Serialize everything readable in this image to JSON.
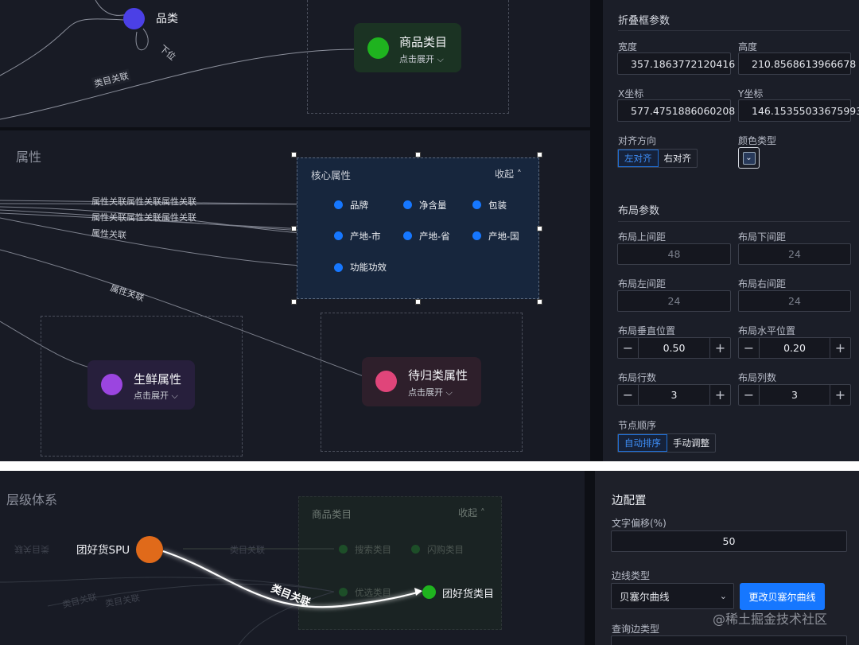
{
  "top_canvas": {
    "node_pinlei": "品类",
    "self_loop_label": "下位",
    "card_shangpin": {
      "title": "商品类目",
      "expand": "点击展开"
    },
    "edge_leimu": "类目关联"
  },
  "mid_canvas": {
    "group_title": "属性",
    "core_group": {
      "title": "核心属性",
      "collapse": "收起"
    },
    "attributes": [
      "品牌",
      "净含量",
      "包装",
      "产地-市",
      "产地-省",
      "产地-国",
      "功能功效"
    ],
    "edge_labels": [
      "属性关联属性关联属性关联",
      "属性关联属性关联属性关联",
      "属性关联",
      "属性关联"
    ],
    "card_shengxian": {
      "title": "生鲜属性",
      "expand": "点击展开"
    },
    "card_daigui": {
      "title": "待归类属性",
      "expand": "点击展开"
    }
  },
  "right_panel_top": {
    "section_fold": "折叠框参数",
    "width_label": "宽度",
    "width_value": "357.1863772120416",
    "height_label": "高度",
    "height_value": "210.8568613966678",
    "x_label": "X坐标",
    "x_value": "577.4751886060208",
    "y_label": "Y坐标",
    "y_value": "146.15355033675993",
    "align_label": "对齐方向",
    "align_left": "左对齐",
    "align_right": "右对齐",
    "color_label": "颜色类型",
    "section_layout": "布局参数",
    "top_gap_label": "布局上间距",
    "top_gap_value": "48",
    "bottom_gap_label": "布局下间距",
    "bottom_gap_value": "24",
    "left_gap_label": "布局左间距",
    "left_gap_value": "24",
    "right_gap_label": "布局右间距",
    "right_gap_value": "24",
    "vpos_label": "布局垂直位置",
    "vpos_value": "0.50",
    "hpos_label": "布局水平位置",
    "hpos_value": "0.20",
    "rows_label": "布局行数",
    "rows_value": "3",
    "cols_label": "布局列数",
    "cols_value": "3",
    "order_label": "节点顺序",
    "order_auto": "自动排序",
    "order_manual": "手动调整"
  },
  "bottom_canvas": {
    "group_title": "层级体系",
    "spu_node": "团好货SPU",
    "category_group": {
      "title": "商品类目",
      "collapse": "收起"
    },
    "faded_nodes": [
      "搜索类目",
      "闪购类目",
      "优选类目"
    ],
    "target_node": "团好货类目",
    "active_edge": "类目关联",
    "faded_edges": [
      "类目关联",
      "类目关联",
      "类目关联",
      "类目关联"
    ]
  },
  "right_panel_bottom": {
    "section_edge": "边配置",
    "text_offset_label": "文字偏移(%)",
    "text_offset_value": "50",
    "edge_type_label": "边线类型",
    "edge_type_value": "贝塞尔曲线",
    "edge_type_button": "更改贝塞尔曲线",
    "query_label": "查询边类型"
  },
  "watermark": "@稀土掘金技术社区",
  "colors": {
    "accent": "#1677ff",
    "canvas": "#181b25",
    "panel": "#1b1e28"
  }
}
